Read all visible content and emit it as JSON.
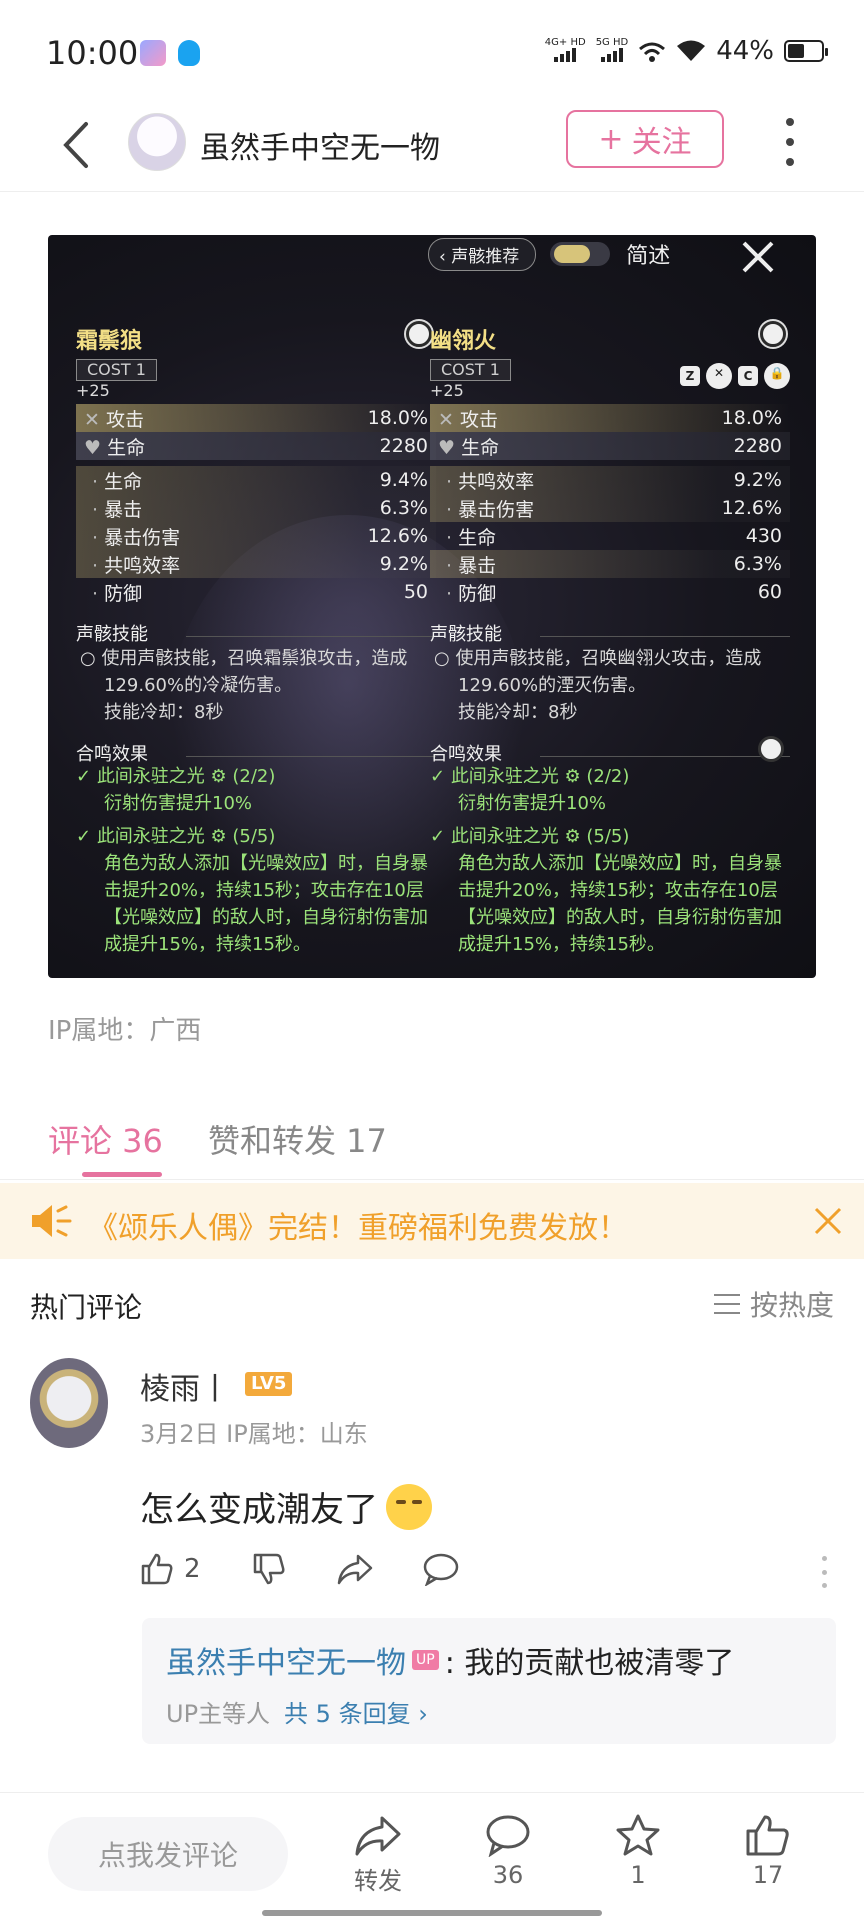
{
  "status_bar": {
    "time": "10:00",
    "network1": "4G+ HD",
    "network2": "5G HD",
    "battery": "44%"
  },
  "header": {
    "author": "虽然手中空无一物",
    "follow_label": "关注",
    "follow_plus": "+"
  },
  "game_card": {
    "echo_button": "声骸推荐",
    "brief_label": "简述",
    "left": {
      "name": "霜鬃狼",
      "cost": "COST 1",
      "level": "+25",
      "main_stats": [
        {
          "label": "攻击",
          "value": "18.0%"
        },
        {
          "label": "生命",
          "value": "2280"
        }
      ],
      "sub_stats": [
        {
          "label": "生命",
          "value": "9.4%"
        },
        {
          "label": "暴击",
          "value": "6.3%"
        },
        {
          "label": "暴击伤害",
          "value": "12.6%"
        },
        {
          "label": "共鸣效率",
          "value": "9.2%"
        },
        {
          "label": "防御",
          "value": "50"
        }
      ],
      "skill_title": "声骸技能",
      "skill_desc": "使用声骸技能，召唤霜鬃狼攻击，造成129.60%的冷凝伤害。",
      "skill_cd": "技能冷却：8秒",
      "bonus_title": "合鸣效果",
      "bonus1_head": "此间永驻之光 ⚙ (2/2)",
      "bonus1_body": "衍射伤害提升10%",
      "bonus2_head": "此间永驻之光 ⚙ (5/5)",
      "bonus2_body": "角色为敌人添加【光噪效应】时，自身暴击提升20%，持续15秒；攻击存在10层【光噪效应】的敌人时，自身衍射伤害加成提升15%，持续15秒。"
    },
    "right": {
      "name": "幽翎火",
      "cost": "COST 1",
      "level": "+25",
      "tags": [
        "Z",
        "C"
      ],
      "main_stats": [
        {
          "label": "攻击",
          "value": "18.0%"
        },
        {
          "label": "生命",
          "value": "2280"
        }
      ],
      "sub_stats": [
        {
          "label": "共鸣效率",
          "value": "9.2%"
        },
        {
          "label": "暴击伤害",
          "value": "12.6%"
        },
        {
          "label": "生命",
          "value": "430"
        },
        {
          "label": "暴击",
          "value": "6.3%"
        },
        {
          "label": "防御",
          "value": "60"
        }
      ],
      "skill_title": "声骸技能",
      "skill_desc": "使用声骸技能，召唤幽翎火攻击，造成129.60%的湮灭伤害。",
      "skill_cd": "技能冷却：8秒",
      "bonus_title": "合鸣效果",
      "bonus1_head": "此间永驻之光 ⚙ (2/2)",
      "bonus1_body": "衍射伤害提升10%",
      "bonus2_head": "此间永驻之光 ⚙ (5/5)",
      "bonus2_body": "角色为敌人添加【光噪效应】时，自身暴击提升20%，持续15秒；攻击存在10层【光噪效应】的敌人时，自身衍射伤害加成提升15%，持续15秒。"
    }
  },
  "ip_location": "IP属地：广西",
  "tabs": [
    {
      "label": "评论 36"
    },
    {
      "label": "赞和转发 17"
    }
  ],
  "notice": "《颂乐人偶》完结！重磅福利免费发放！",
  "hot_comments": {
    "title": "热门评论",
    "sort_label": "按热度"
  },
  "comment": {
    "user": "棱雨丨",
    "level": "LV5",
    "meta": "3月2日 IP属地：山东",
    "text": "怎么变成潮友了",
    "likes": "2",
    "reply_user": "虽然手中空无一物",
    "reply_badge": "UP",
    "reply_text": ": 我的贡献也被清零了",
    "reply_summary": "UP主等人",
    "reply_count": "共 5 条回复 ›"
  },
  "bottom_bar": {
    "input_placeholder": "点我发评论",
    "share_label": "转发",
    "comments_count": "36",
    "favorites_count": "1",
    "likes_count": "17"
  }
}
